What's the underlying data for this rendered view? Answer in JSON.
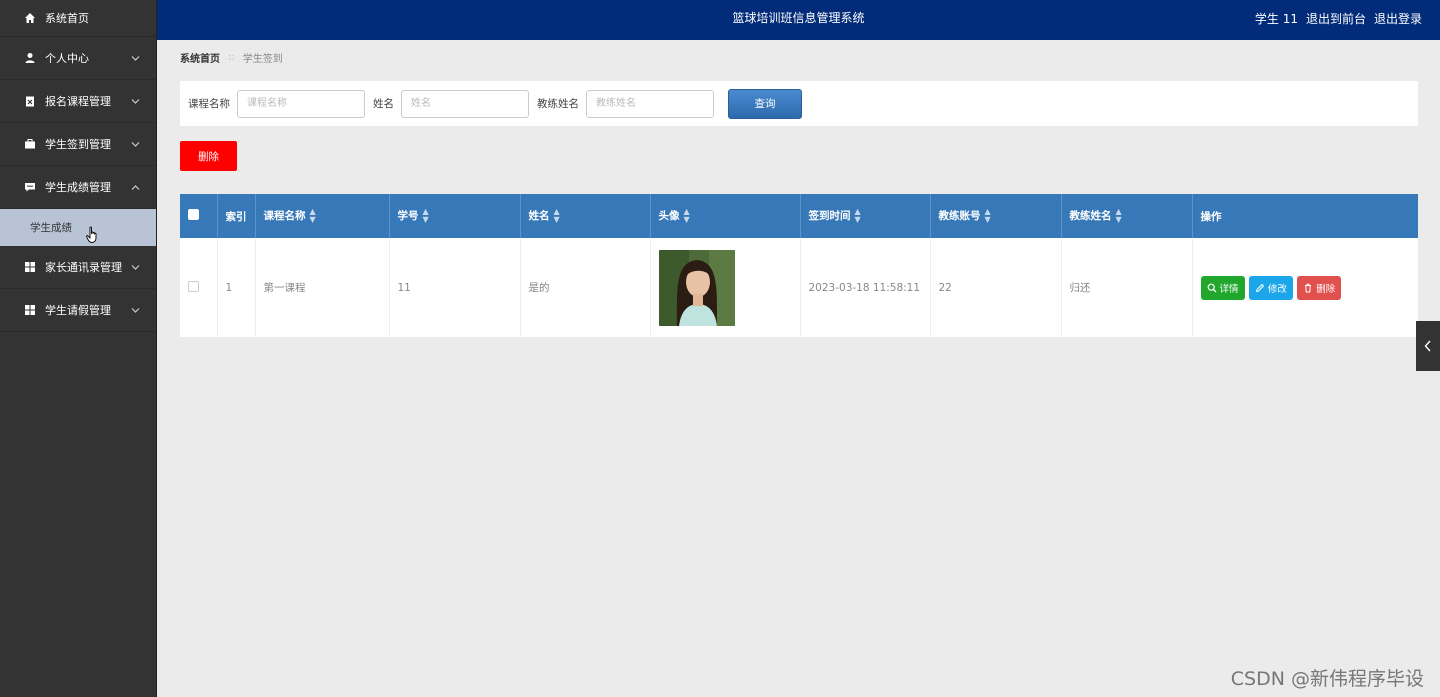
{
  "app": {
    "title": "篮球培训班信息管理系统",
    "user_label": "学生 11",
    "back_front": "退出到前台",
    "logout": "退出登录"
  },
  "sidebar": {
    "items": [
      {
        "label": "系统首页",
        "icon": "home-icon"
      },
      {
        "label": "个人中心",
        "icon": "user-icon"
      },
      {
        "label": "报名课程管理",
        "icon": "clipboard-icon"
      },
      {
        "label": "学生签到管理",
        "icon": "briefcase-icon"
      },
      {
        "label": "学生成绩管理",
        "icon": "chat-icon",
        "expanded": true
      },
      {
        "label": "家长通讯录管理",
        "icon": "grid-icon"
      },
      {
        "label": "学生请假管理",
        "icon": "grid-icon"
      }
    ],
    "sub_items": [
      {
        "label": "学生成绩"
      }
    ]
  },
  "breadcrumb": {
    "home": "系统首页",
    "separator": "::",
    "current": "学生签到"
  },
  "search": {
    "course_label": "课程名称",
    "course_placeholder": "课程名称",
    "name_label": "姓名",
    "name_placeholder": "姓名",
    "coach_label": "教练姓名",
    "coach_placeholder": "教练姓名",
    "query_button": "查询"
  },
  "toolbar": {
    "delete_button": "删除"
  },
  "table": {
    "headers": [
      "索引",
      "课程名称",
      "学号",
      "姓名",
      "头像",
      "签到时间",
      "教练账号",
      "教练姓名",
      "操作"
    ],
    "rows": [
      {
        "index": "1",
        "course": "第一课程",
        "student_no": "11",
        "name": "是的",
        "sign_time": "2023-03-18 11:58:11",
        "coach_account": "22",
        "coach_name": "归还"
      }
    ],
    "actions": {
      "detail": "详情",
      "edit": "修改",
      "delete": "删除"
    }
  },
  "watermark": "CSDN @新伟程序毕设",
  "colors": {
    "topbar": "#022c7a",
    "sidebar": "#333333",
    "table_header": "#3778b8",
    "delete_red": "#ff0000",
    "detail_green": "#22a72d",
    "edit_blue": "#1aa6e8",
    "delete_btn": "#e0514e"
  }
}
